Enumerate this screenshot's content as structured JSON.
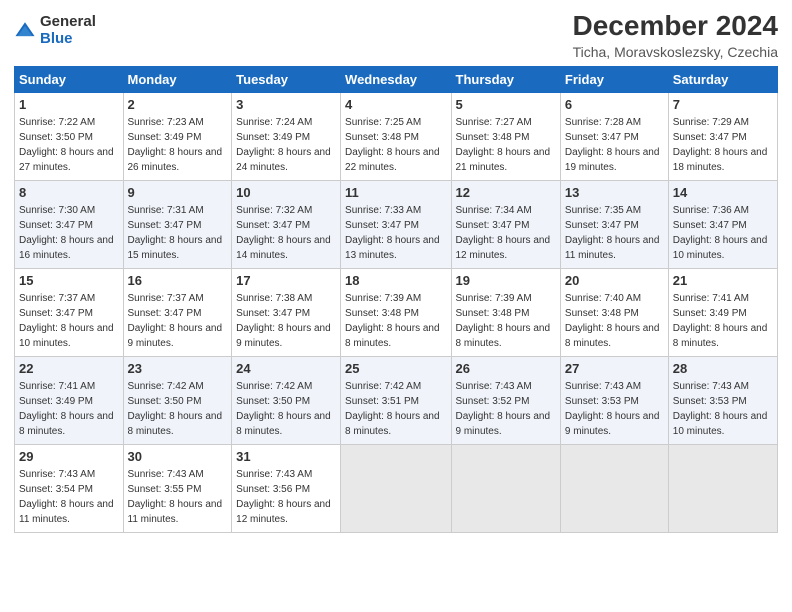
{
  "logo": {
    "general": "General",
    "blue": "Blue"
  },
  "title": "December 2024",
  "location": "Ticha, Moravskoslezsky, Czechia",
  "days_of_week": [
    "Sunday",
    "Monday",
    "Tuesday",
    "Wednesday",
    "Thursday",
    "Friday",
    "Saturday"
  ],
  "weeks": [
    [
      {
        "day": "1",
        "sunrise": "7:22 AM",
        "sunset": "3:50 PM",
        "daylight": "8 hours and 27 minutes."
      },
      {
        "day": "2",
        "sunrise": "7:23 AM",
        "sunset": "3:49 PM",
        "daylight": "8 hours and 26 minutes."
      },
      {
        "day": "3",
        "sunrise": "7:24 AM",
        "sunset": "3:49 PM",
        "daylight": "8 hours and 24 minutes."
      },
      {
        "day": "4",
        "sunrise": "7:25 AM",
        "sunset": "3:48 PM",
        "daylight": "8 hours and 22 minutes."
      },
      {
        "day": "5",
        "sunrise": "7:27 AM",
        "sunset": "3:48 PM",
        "daylight": "8 hours and 21 minutes."
      },
      {
        "day": "6",
        "sunrise": "7:28 AM",
        "sunset": "3:47 PM",
        "daylight": "8 hours and 19 minutes."
      },
      {
        "day": "7",
        "sunrise": "7:29 AM",
        "sunset": "3:47 PM",
        "daylight": "8 hours and 18 minutes."
      }
    ],
    [
      {
        "day": "8",
        "sunrise": "7:30 AM",
        "sunset": "3:47 PM",
        "daylight": "8 hours and 16 minutes."
      },
      {
        "day": "9",
        "sunrise": "7:31 AM",
        "sunset": "3:47 PM",
        "daylight": "8 hours and 15 minutes."
      },
      {
        "day": "10",
        "sunrise": "7:32 AM",
        "sunset": "3:47 PM",
        "daylight": "8 hours and 14 minutes."
      },
      {
        "day": "11",
        "sunrise": "7:33 AM",
        "sunset": "3:47 PM",
        "daylight": "8 hours and 13 minutes."
      },
      {
        "day": "12",
        "sunrise": "7:34 AM",
        "sunset": "3:47 PM",
        "daylight": "8 hours and 12 minutes."
      },
      {
        "day": "13",
        "sunrise": "7:35 AM",
        "sunset": "3:47 PM",
        "daylight": "8 hours and 11 minutes."
      },
      {
        "day": "14",
        "sunrise": "7:36 AM",
        "sunset": "3:47 PM",
        "daylight": "8 hours and 10 minutes."
      }
    ],
    [
      {
        "day": "15",
        "sunrise": "7:37 AM",
        "sunset": "3:47 PM",
        "daylight": "8 hours and 10 minutes."
      },
      {
        "day": "16",
        "sunrise": "7:37 AM",
        "sunset": "3:47 PM",
        "daylight": "8 hours and 9 minutes."
      },
      {
        "day": "17",
        "sunrise": "7:38 AM",
        "sunset": "3:47 PM",
        "daylight": "8 hours and 9 minutes."
      },
      {
        "day": "18",
        "sunrise": "7:39 AM",
        "sunset": "3:48 PM",
        "daylight": "8 hours and 8 minutes."
      },
      {
        "day": "19",
        "sunrise": "7:39 AM",
        "sunset": "3:48 PM",
        "daylight": "8 hours and 8 minutes."
      },
      {
        "day": "20",
        "sunrise": "7:40 AM",
        "sunset": "3:48 PM",
        "daylight": "8 hours and 8 minutes."
      },
      {
        "day": "21",
        "sunrise": "7:41 AM",
        "sunset": "3:49 PM",
        "daylight": "8 hours and 8 minutes."
      }
    ],
    [
      {
        "day": "22",
        "sunrise": "7:41 AM",
        "sunset": "3:49 PM",
        "daylight": "8 hours and 8 minutes."
      },
      {
        "day": "23",
        "sunrise": "7:42 AM",
        "sunset": "3:50 PM",
        "daylight": "8 hours and 8 minutes."
      },
      {
        "day": "24",
        "sunrise": "7:42 AM",
        "sunset": "3:50 PM",
        "daylight": "8 hours and 8 minutes."
      },
      {
        "day": "25",
        "sunrise": "7:42 AM",
        "sunset": "3:51 PM",
        "daylight": "8 hours and 8 minutes."
      },
      {
        "day": "26",
        "sunrise": "7:43 AM",
        "sunset": "3:52 PM",
        "daylight": "8 hours and 9 minutes."
      },
      {
        "day": "27",
        "sunrise": "7:43 AM",
        "sunset": "3:53 PM",
        "daylight": "8 hours and 9 minutes."
      },
      {
        "day": "28",
        "sunrise": "7:43 AM",
        "sunset": "3:53 PM",
        "daylight": "8 hours and 10 minutes."
      }
    ],
    [
      {
        "day": "29",
        "sunrise": "7:43 AM",
        "sunset": "3:54 PM",
        "daylight": "8 hours and 11 minutes."
      },
      {
        "day": "30",
        "sunrise": "7:43 AM",
        "sunset": "3:55 PM",
        "daylight": "8 hours and 11 minutes."
      },
      {
        "day": "31",
        "sunrise": "7:43 AM",
        "sunset": "3:56 PM",
        "daylight": "8 hours and 12 minutes."
      },
      null,
      null,
      null,
      null
    ]
  ]
}
